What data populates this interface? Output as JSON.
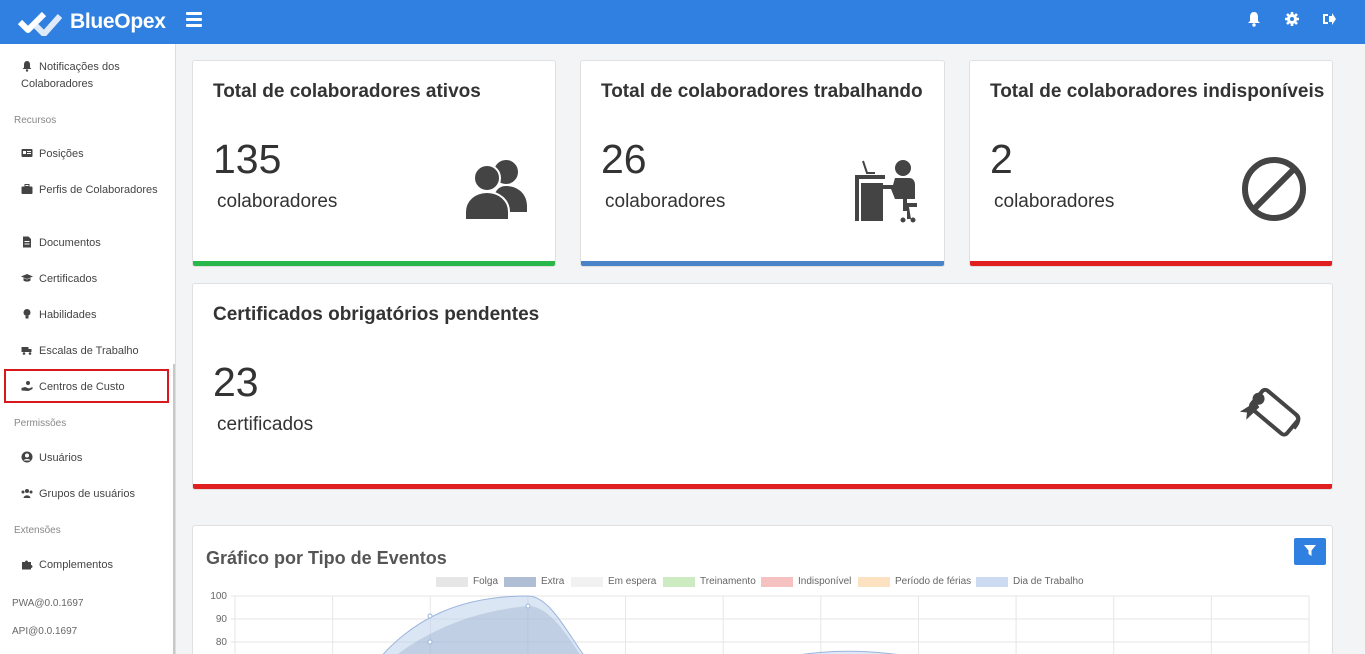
{
  "app": {
    "brand": "BlueOpex"
  },
  "topbar": {
    "icons": [
      "menu-icon",
      "bell-icon",
      "gear-icon",
      "logout-icon"
    ]
  },
  "sidebar": {
    "items": [
      {
        "label": "Notificações dos Colaboradores",
        "icon": "bell-icon"
      },
      {
        "label": "Posições",
        "icon": "id-card-icon"
      },
      {
        "label": "Perfis de Colaboradores",
        "icon": "briefcase-icon"
      },
      {
        "label": "Documentos",
        "icon": "file-icon"
      },
      {
        "label": "Certificados",
        "icon": "graduation-cap-icon"
      },
      {
        "label": "Habilidades",
        "icon": "lightbulb-icon"
      },
      {
        "label": "Escalas de Trabalho",
        "icon": "truck-clock-icon"
      },
      {
        "label": "Centros de Custo",
        "icon": "hand-coin-icon"
      },
      {
        "label": "Usuários",
        "icon": "user-circle-icon"
      },
      {
        "label": "Grupos de usuários",
        "icon": "users-icon"
      },
      {
        "label": "Complementos",
        "icon": "puzzle-icon"
      }
    ],
    "sections": [
      "Recursos",
      "Permissões",
      "Extensões"
    ],
    "versions": [
      "PWA@0.0.1697",
      "API@0.0.1697"
    ],
    "selected": "Centros de Custo"
  },
  "cards": [
    {
      "title": "Total de colaboradores ativos",
      "value": "135",
      "unit": "colaboradores",
      "icon": "users-group-icon",
      "bar_color": "#27b74a"
    },
    {
      "title": "Total de colaboradores trabalhando",
      "value": "26",
      "unit": "colaboradores",
      "icon": "person-at-desk-icon",
      "bar_color": "#4a83c8"
    },
    {
      "title": "Total de colaboradores indisponíveis",
      "value": "2",
      "unit": "colaboradores",
      "icon": "ban-icon",
      "bar_color": "#e02020"
    },
    {
      "title": "Certificados obrigatórios pendentes",
      "value": "23",
      "unit": "certificados",
      "icon": "certificate-scroll-icon",
      "bar_color": "#e02020"
    }
  ],
  "chart_card": {
    "title": "Gráfico por Tipo de Eventos",
    "filter_icon": "filter-icon"
  },
  "chart_data": {
    "type": "area",
    "legend": [
      {
        "name": "Folga",
        "color": "#dcdcdc"
      },
      {
        "name": "Extra",
        "color": "#8ea3c2"
      },
      {
        "name": "Em espera",
        "color": "#ececec"
      },
      {
        "name": "Treinamento",
        "color": "#b9e3a8"
      },
      {
        "name": "Indisponível",
        "color": "#f3a7a7"
      },
      {
        "name": "Período de férias",
        "color": "#fbd6a8"
      },
      {
        "name": "Dia de Trabalho",
        "color": "#b7cdec"
      }
    ],
    "y_ticks": [
      "100",
      "90",
      "80"
    ],
    "ylim": [
      70,
      100
    ],
    "grid": true,
    "legend_position": "top"
  }
}
